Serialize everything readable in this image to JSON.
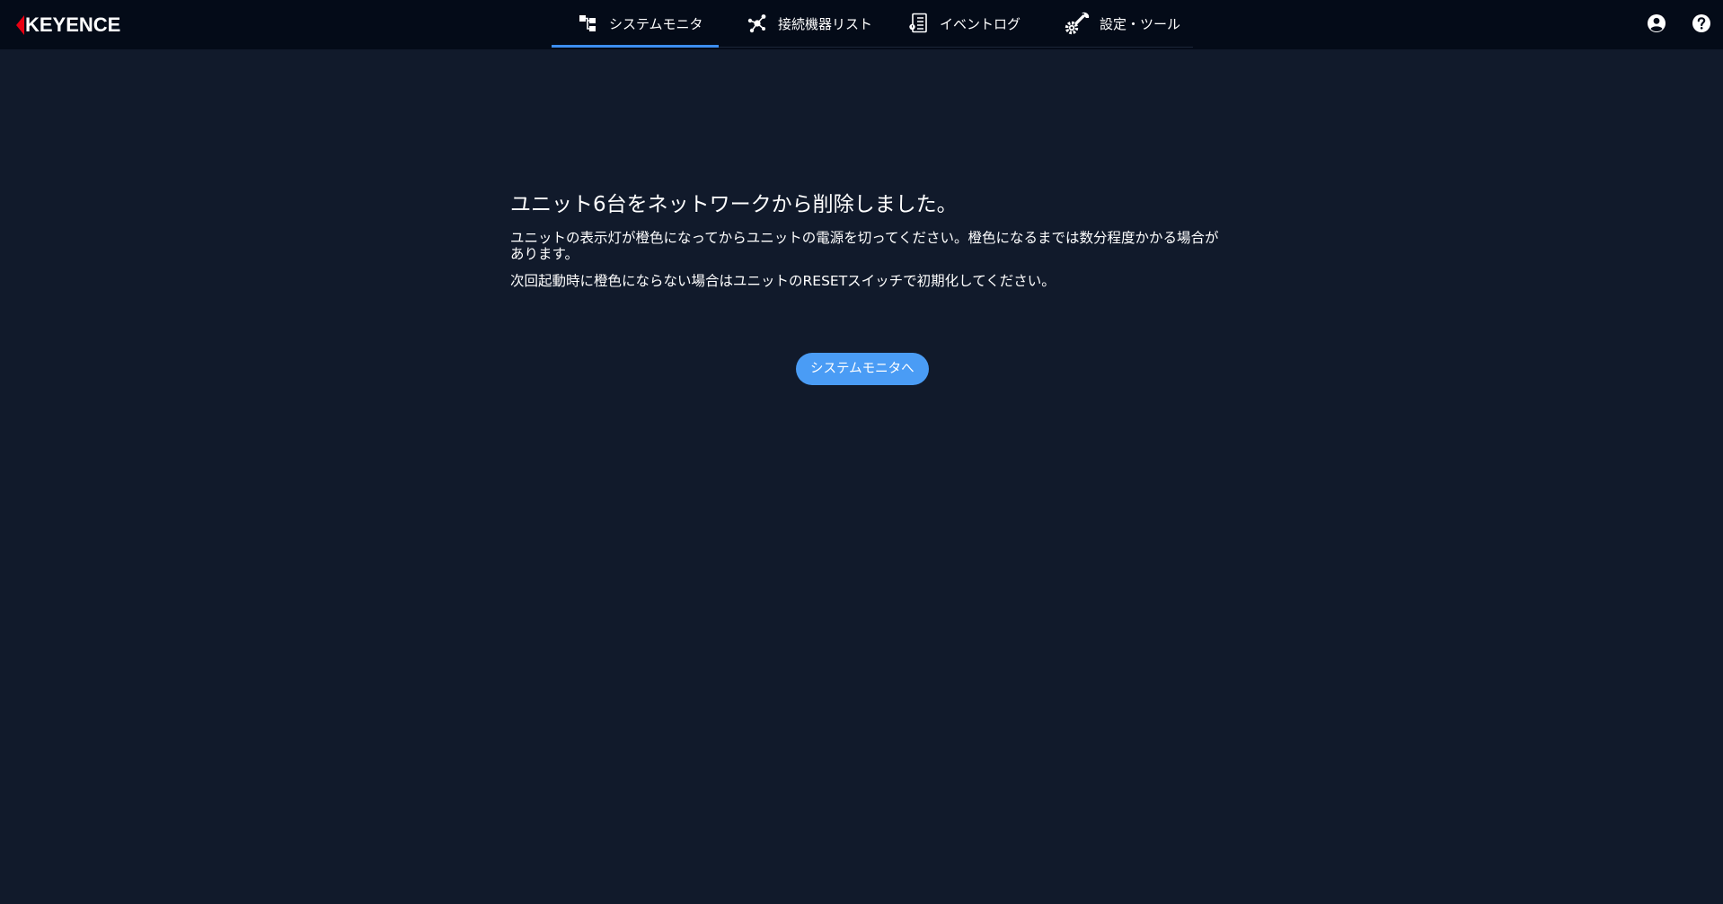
{
  "brand": {
    "name": "KEYENCE",
    "accent": "#e60012"
  },
  "nav": {
    "items": [
      {
        "label": "システムモニタ",
        "icon": "system-monitor-icon",
        "active": true
      },
      {
        "label": "接続機器リスト",
        "icon": "connected-devices-icon",
        "active": false
      },
      {
        "label": "イベントログ",
        "icon": "event-log-icon",
        "active": false
      },
      {
        "label": "設定・ツール",
        "icon": "settings-tools-icon",
        "active": false
      }
    ]
  },
  "toolbar": {
    "user_icon": "user-account-icon",
    "help_icon": "help-icon"
  },
  "message": {
    "title": "ユニット6台をネットワークから削除しました。",
    "line1": "ユニットの表示灯が橙色になってからユニットの電源を切ってください。橙色になるまでは数分程度かかる場合があります。",
    "line2": "次回起動時に橙色にならない場合はユニットのRESETスイッチで初期化してください。"
  },
  "actions": {
    "back_label": "システムモニタへ"
  },
  "colors": {
    "background": "#111a2b",
    "header": "#040b18",
    "primary": "#4a9cf5",
    "active_tab": "#3d8ef0"
  }
}
